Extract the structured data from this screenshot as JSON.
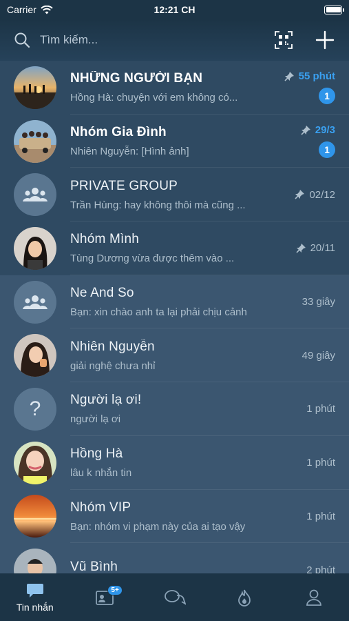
{
  "status_bar": {
    "carrier": "Carrier",
    "time": "12:21 CH"
  },
  "search": {
    "placeholder": "Tìm kiếm..."
  },
  "conversations": [
    {
      "title": "NHỮNG NGƯỜI BẠN",
      "preview": "Hồng Hà: chuyện với em không có...",
      "time": "55 phút",
      "pinned": true,
      "unread": "1",
      "bold": true
    },
    {
      "title": "Nhóm Gia Đình",
      "preview": "Nhiên Nguyễn: [Hình ảnh]",
      "time": "29/3",
      "pinned": true,
      "unread": "1",
      "bold": true
    },
    {
      "title": "PRIVATE GROUP",
      "preview": "Trần Hùng: hay không thôi mà cũng ...",
      "time": "02/12",
      "pinned": true
    },
    {
      "title": "Nhóm Mình",
      "preview": "Tùng Dương vừa được thêm vào ...",
      "time": "20/11",
      "pinned": true
    },
    {
      "title": "Ne And So",
      "preview": "Bạn: xin chào anh ta lại phải chịu cảnh",
      "time": "33 giây"
    },
    {
      "title": "Nhiên Nguyễn",
      "preview": "giải nghệ chưa nhỉ",
      "time": "49 giây"
    },
    {
      "title": "Người lạ ơi!",
      "preview": "người lạ ơi",
      "time": "1 phút"
    },
    {
      "title": "Hồng Hà",
      "preview": "lâu k nhắn tin",
      "time": "1 phút"
    },
    {
      "title": "Nhóm VIP",
      "preview": "Bạn: nhóm vi phạm này của ai tạo vậy",
      "time": "1 phút"
    },
    {
      "title": "Vũ Bình",
      "preview": "",
      "time": "2 phút"
    }
  ],
  "tabbar": {
    "messages_label": "Tin nhắn",
    "contacts_badge": "5+"
  },
  "colors": {
    "accent": "#2f95ea",
    "background": "#3b5670",
    "bar": "#1c3446"
  }
}
